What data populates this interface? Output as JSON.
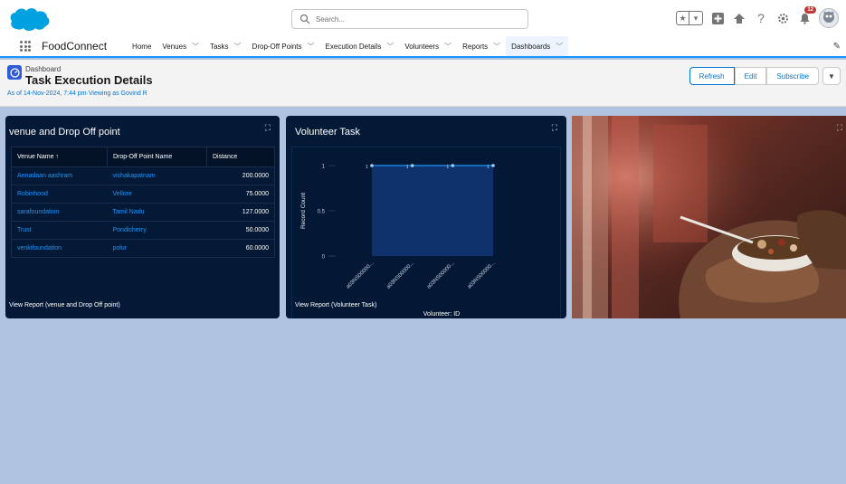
{
  "header": {
    "search_placeholder": "Search...",
    "notification_count": "12"
  },
  "nav": {
    "app_name": "FoodConnect",
    "items": [
      {
        "label": "Home",
        "has_menu": false
      },
      {
        "label": "Venues",
        "has_menu": true
      },
      {
        "label": "Tasks",
        "has_menu": true
      },
      {
        "label": "Drop-Off Points",
        "has_menu": true
      },
      {
        "label": "Execution Details",
        "has_menu": true
      },
      {
        "label": "Volunteers",
        "has_menu": true
      },
      {
        "label": "Reports",
        "has_menu": true
      },
      {
        "label": "Dashboards",
        "has_menu": true
      }
    ]
  },
  "dashboard": {
    "label": "Dashboard",
    "title": "Task Execution Details",
    "subtitle": "As of 14-Nov-2024, 7:44 pm·Viewing as Govind R",
    "buttons": {
      "refresh": "Refresh",
      "edit": "Edit",
      "subscribe": "Subscribe"
    }
  },
  "table_panel": {
    "title": "venue and Drop Off point",
    "columns": [
      "Venue Name ↑",
      "Drop-Off Point Name",
      "Distance"
    ],
    "rows": [
      [
        "Annadaan aashram",
        "vishakapatnam",
        "200.0000"
      ],
      [
        "Robinhood",
        "Vellore",
        "75.0000"
      ],
      [
        "sarafoundation",
        "Tamil Nadu",
        "127.0000"
      ],
      [
        "Trust",
        "Pondicherry",
        "50.0000"
      ],
      [
        "venkifoundation",
        "polur",
        "60.0000"
      ]
    ],
    "view_report": "View Report (venue and Drop Off point)"
  },
  "chart_panel": {
    "title": "Volunteer Task",
    "view_report": "View Report (Volunteer Task)"
  },
  "chart_data": {
    "type": "area",
    "categories": [
      "a03NS00000...",
      "a03NS00000...",
      "a03NS00000...",
      "a03NS00000..."
    ],
    "values": [
      1,
      1,
      1,
      1
    ],
    "data_labels": [
      "1",
      "1",
      "1",
      "1"
    ],
    "xlabel": "Volunteer: ID",
    "ylabel": "Record Count",
    "ylim": [
      0,
      1
    ],
    "yticks": [
      "0",
      "0.5",
      "1"
    ],
    "color": "#1b96ff"
  }
}
